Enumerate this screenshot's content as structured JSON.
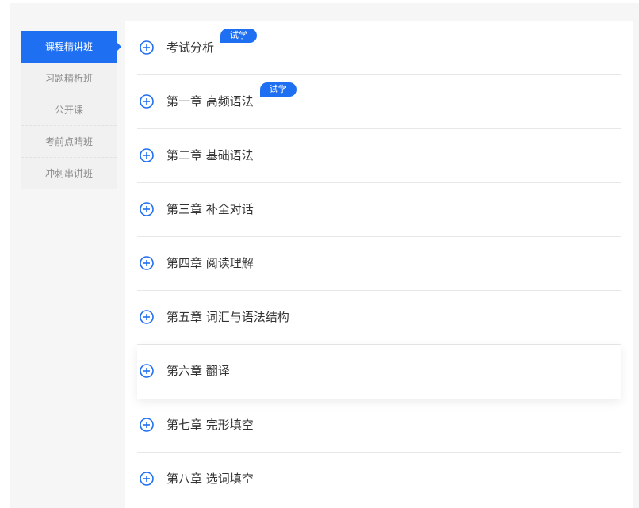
{
  "sidebar": {
    "items": [
      {
        "label": "课程精讲班",
        "active": true
      },
      {
        "label": "习题精析班",
        "active": false
      },
      {
        "label": "公开课",
        "active": false
      },
      {
        "label": "考前点睛班",
        "active": false
      },
      {
        "label": "冲刺串讲班",
        "active": false
      }
    ]
  },
  "chapters": [
    {
      "title": "考试分析",
      "badge": "试学",
      "icon": "plus-circle-icon"
    },
    {
      "title": "第一章 高频语法",
      "badge": "试学",
      "icon": "plus-circle-icon"
    },
    {
      "title": "第二章 基础语法",
      "badge": "",
      "icon": "plus-circle-icon"
    },
    {
      "title": "第三章 补全对话",
      "badge": "",
      "icon": "plus-circle-icon"
    },
    {
      "title": "第四章 阅读理解",
      "badge": "",
      "icon": "plus-circle-icon"
    },
    {
      "title": "第五章 词汇与语法结构",
      "badge": "",
      "icon": "plus-circle-icon"
    },
    {
      "title": "第六章 翻译",
      "badge": "",
      "icon": "plus-circle-icon"
    },
    {
      "title": "第七章 完形填空",
      "badge": "",
      "icon": "plus-circle-icon"
    },
    {
      "title": "第八章 选词填空",
      "badge": "",
      "icon": "plus-circle-icon"
    }
  ],
  "colors": {
    "accent": "#1f6ff2",
    "text": "#333333",
    "muted": "#8c8c8c"
  }
}
